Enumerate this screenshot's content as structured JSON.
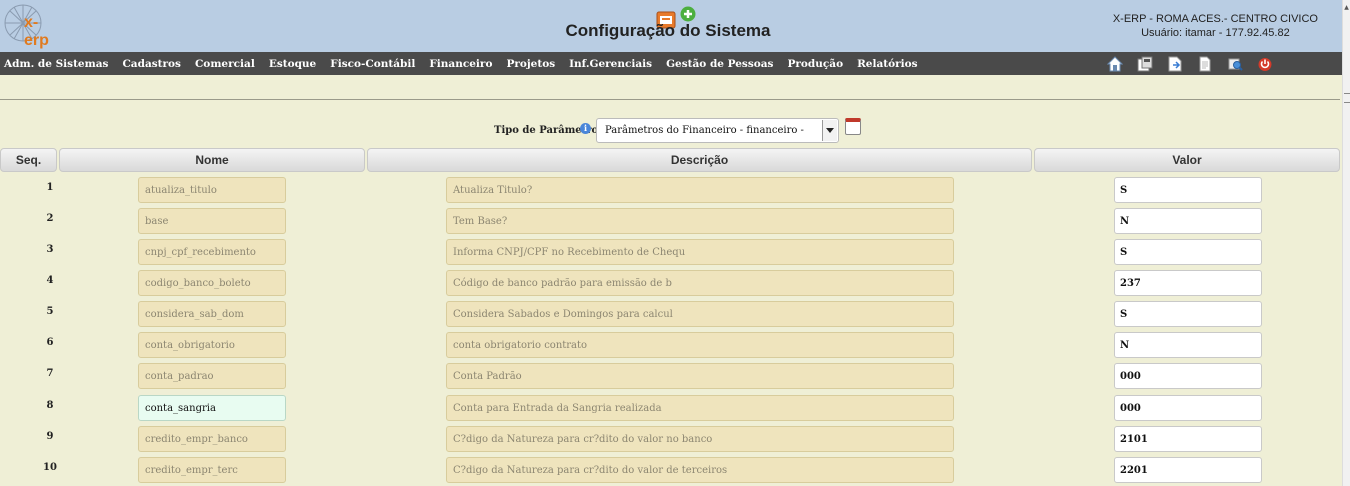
{
  "header": {
    "logo_text": "x-erp",
    "title": "Configuração do Sistema",
    "company": "X-ERP - ROMA ACES.- CENTRO CIVICO",
    "user": "Usuário: itamar - 177.92.45.82"
  },
  "menu": {
    "items": [
      "Adm. de Sistemas",
      "Cadastros",
      "Comercial",
      "Estoque",
      "Fisco-Contábil",
      "Financeiro",
      "Projetos",
      "Inf.Gerenciais",
      "Gestão de Pessoas",
      "Produção",
      "Relatórios"
    ],
    "icons": [
      "home-icon",
      "save-icon",
      "export-icon",
      "document-icon",
      "search-icon",
      "power-icon"
    ]
  },
  "filter": {
    "label": "Tipo de Parâmetro",
    "selected": "Parâmetros do Financeiro - financeiro -"
  },
  "table": {
    "headers": {
      "seq": "Seq.",
      "nome": "Nome",
      "descricao": "Descrição",
      "valor": "Valor"
    },
    "rows": [
      {
        "seq": "1",
        "nome": "atualiza_titulo",
        "descricao": "Atualiza Titulo?",
        "valor": "S"
      },
      {
        "seq": "2",
        "nome": "base",
        "descricao": "Tem Base?",
        "valor": "N"
      },
      {
        "seq": "3",
        "nome": "cnpj_cpf_recebimento",
        "descricao": "Informa CNPJ/CPF no Recebimento de Chequ",
        "valor": "S"
      },
      {
        "seq": "4",
        "nome": "codigo_banco_boleto",
        "descricao": "Código de banco padrão para emissão de b",
        "valor": "237"
      },
      {
        "seq": "5",
        "nome": "considera_sab_dom",
        "descricao": "Considera Sabados e Domingos para calcul",
        "valor": "S"
      },
      {
        "seq": "6",
        "nome": "conta_obrigatorio",
        "descricao": "conta obrigatorio contrato",
        "valor": "N"
      },
      {
        "seq": "7",
        "nome": "conta_padrao",
        "descricao": "Conta Padrão",
        "valor": "000"
      },
      {
        "seq": "8",
        "nome": "conta_sangria",
        "descricao": "Conta para Entrada da Sangria realizada",
        "valor": "000"
      },
      {
        "seq": "9",
        "nome": "credito_empr_banco",
        "descricao": "C?digo da Natureza para cr?dito do valor no banco",
        "valor": "2101"
      },
      {
        "seq": "10",
        "nome": "credito_empr_terc",
        "descricao": "C?digo da Natureza para cr?dito do valor de terceiros",
        "valor": "2201"
      }
    ]
  },
  "colors": {
    "header_bg": "#b9cde3",
    "menubar_bg": "#4a4a4a",
    "page_bg": "#efefd6",
    "readonly_field": "#efe4bd",
    "active_field": "#e8fcf1"
  }
}
